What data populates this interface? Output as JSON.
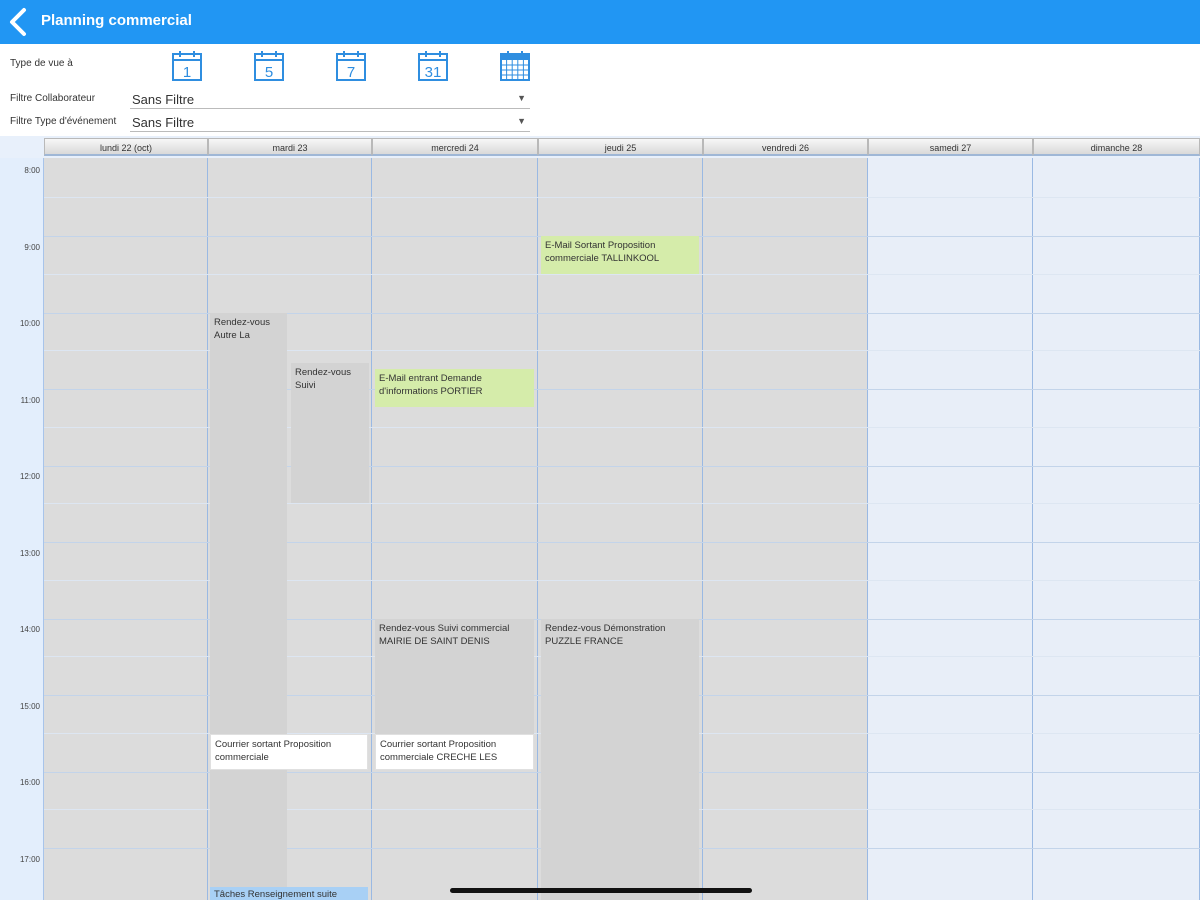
{
  "header": {
    "title": "Planning commercial"
  },
  "controls": {
    "view_type_label": "Type de vue à",
    "view_icons": [
      {
        "number": "1"
      },
      {
        "number": "5"
      },
      {
        "number": "7"
      },
      {
        "number": "31"
      },
      {
        "number": ""
      }
    ],
    "collab_filter": {
      "label": "Filtre Collaborateur",
      "value": "Sans Filtre"
    },
    "event_type_filter": {
      "label": "Filtre Type d'événement",
      "value": "Sans Filtre"
    }
  },
  "calendar": {
    "days": [
      {
        "label": "lundi 22 (oct)"
      },
      {
        "label": "mardi 23"
      },
      {
        "label": "mercredi 24"
      },
      {
        "label": "jeudi 25"
      },
      {
        "label": "vendredi 26"
      },
      {
        "label": "samedi 27"
      },
      {
        "label": "dimanche 28"
      }
    ],
    "hours": [
      "8:00",
      "9:00",
      "10:00",
      "11:00",
      "12:00",
      "13:00",
      "14:00",
      "15:00",
      "16:00",
      "17:00"
    ],
    "events": [
      {
        "text": "Rendez-vous Autre La"
      },
      {
        "text": "Rendez-vous Suivi"
      },
      {
        "text": "E-Mail entrant Demande d'informations PORTIER"
      },
      {
        "text": "E-Mail Sortant Proposition commerciale TALLINKOOL"
      },
      {
        "text": "Rendez-vous Suivi commercial MAIRIE DE SAINT DENIS"
      },
      {
        "text": "Rendez-vous Démonstration PUZZLE FRANCE"
      },
      {
        "text": "Courrier sortant Proposition commerciale"
      },
      {
        "text": "Courrier sortant Proposition commerciale CRECHE LES"
      },
      {
        "text": "Tâches Renseignement suite"
      }
    ]
  },
  "colors": {
    "header_bg": "#2196f3",
    "icon_blue": "#2f8ee0",
    "event_green": "#d5ecaa",
    "event_gray": "#d3d3d3",
    "weekend_bg": "#e8eef8"
  }
}
